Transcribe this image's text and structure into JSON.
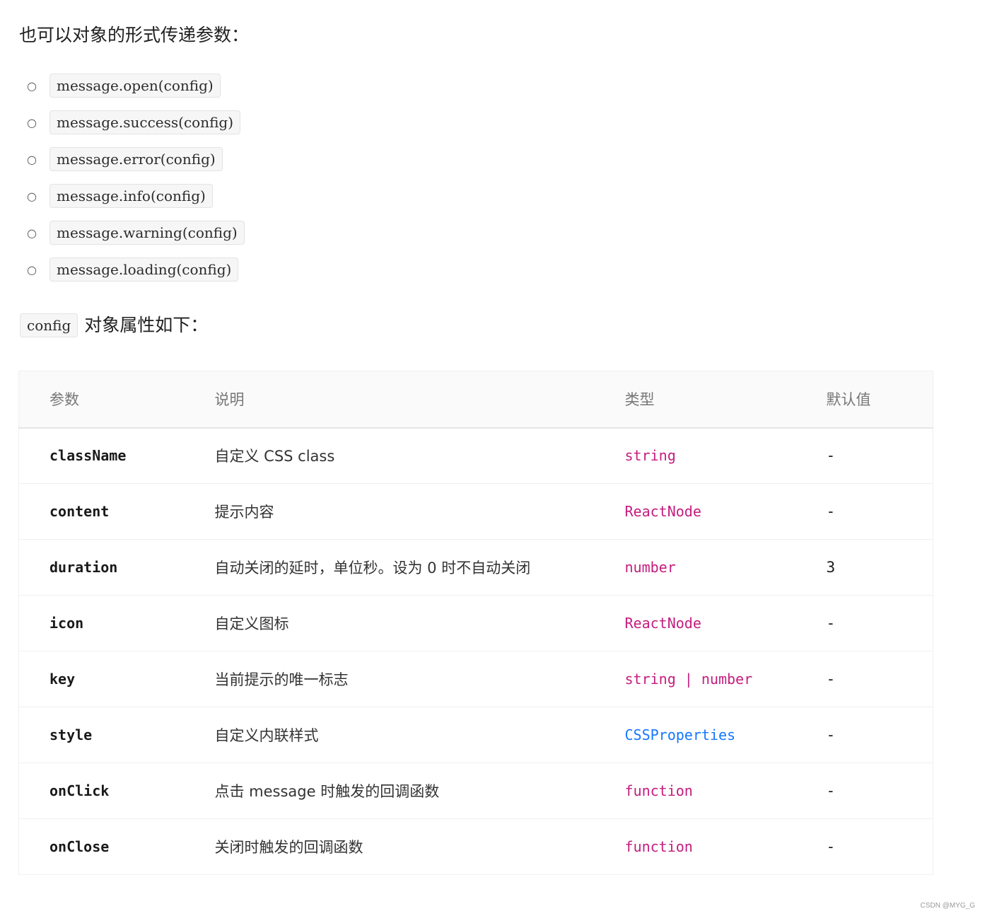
{
  "intro": "也可以对象的形式传递参数：",
  "methods": [
    "message.open(config)",
    "message.success(config)",
    "message.error(config)",
    "message.info(config)",
    "message.warning(config)",
    "message.loading(config)"
  ],
  "bullet_glyph": "○",
  "config_label": {
    "code": "config",
    "text": "对象属性如下："
  },
  "table": {
    "headers": [
      "参数",
      "说明",
      "类型",
      "默认值"
    ],
    "rows": [
      {
        "name": "className",
        "desc": "自定义 CSS class",
        "type": "string",
        "default": "-"
      },
      {
        "name": "content",
        "desc": "提示内容",
        "type": "ReactNode",
        "default": "-"
      },
      {
        "name": "duration",
        "desc": "自动关闭的延时，单位秒。设为 0 时不自动关闭",
        "type": "number",
        "default": "3"
      },
      {
        "name": "icon",
        "desc": "自定义图标",
        "type": "ReactNode",
        "default": "-"
      },
      {
        "name": "key",
        "desc": "当前提示的唯一标志",
        "type": "string | number",
        "default": "-"
      },
      {
        "name": "style",
        "desc": "自定义内联样式",
        "type": "CSSProperties",
        "default": "-"
      },
      {
        "name": "onClick",
        "desc": "点击 message 时触发的回调函数",
        "type": "function",
        "default": "-"
      },
      {
        "name": "onClose",
        "desc": "关闭时触发的回调函数",
        "type": "function",
        "default": "-"
      }
    ]
  },
  "colors": {
    "type_text": "#c41d7f",
    "type_link": "#1677ff",
    "header_bg": "#fafafa"
  },
  "watermark": "CSDN @MYG_G"
}
